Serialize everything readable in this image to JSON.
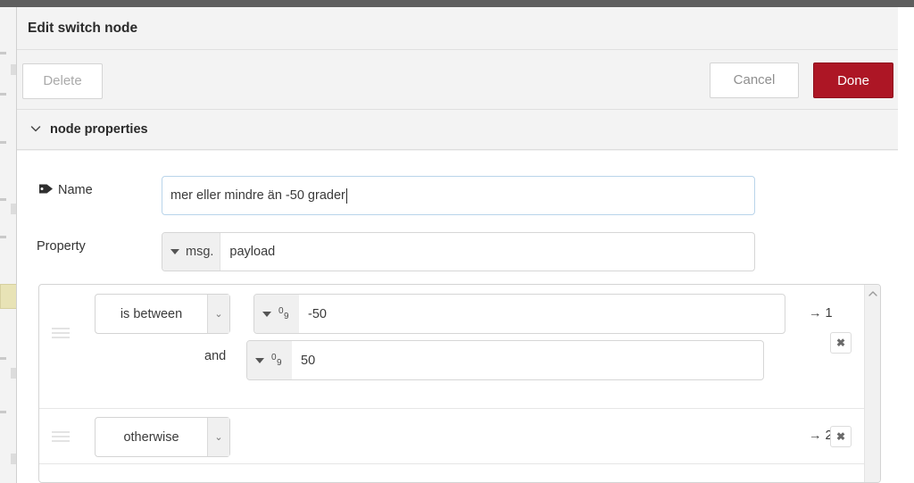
{
  "dialog": {
    "title": "Edit switch node",
    "buttons": {
      "delete": "Delete",
      "cancel": "Cancel",
      "done": "Done"
    },
    "section": {
      "label": "node properties",
      "chevron_icon": "chevron-down-icon"
    }
  },
  "form": {
    "name": {
      "label": "Name",
      "icon": "tag-icon",
      "value": "mer eller mindre än -50 grader"
    },
    "property": {
      "label": "Property",
      "type_prefix": "msg.",
      "value": "payload",
      "dropdown_icon": "triangle-down-icon"
    }
  },
  "rules": [
    {
      "handle_icon": "drag-handle-icon",
      "operator": "is between",
      "value1": {
        "type_icon": "number-type-icon",
        "type_glyph_top": "0",
        "type_glyph_bottom": "9",
        "value": "-50"
      },
      "and_label": "and",
      "value2": {
        "type_icon": "number-type-icon",
        "type_glyph_top": "0",
        "type_glyph_bottom": "9",
        "value": "50"
      },
      "output": "→ 1",
      "delete_label": "✖"
    },
    {
      "handle_icon": "drag-handle-icon",
      "operator": "otherwise",
      "output": "→ 2",
      "delete_label": "✖"
    }
  ],
  "scrollbar": {
    "up_icon": "chevron-up-icon"
  },
  "colors": {
    "brand_red": "#ad1625",
    "topbar": "#5e5e5e",
    "panel_bg": "#f3f3f3",
    "focus_border": "#b9d4ea"
  }
}
